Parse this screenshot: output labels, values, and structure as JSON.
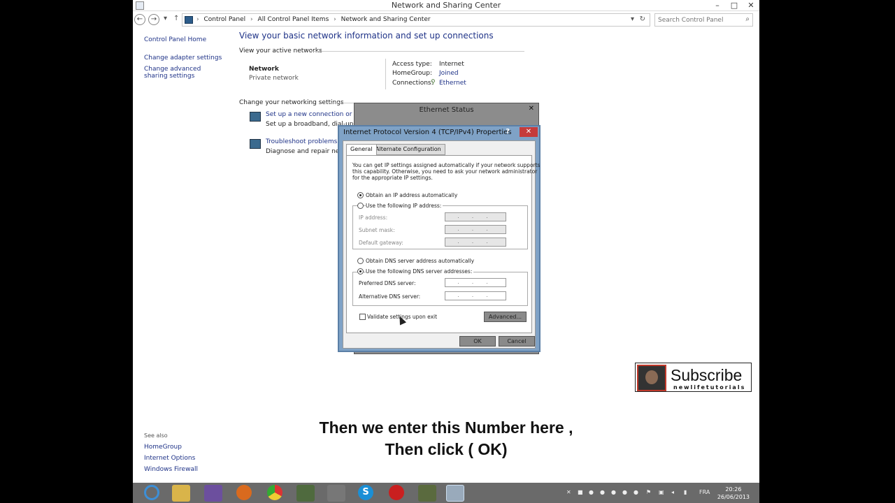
{
  "window": {
    "title": "Network and Sharing Center",
    "minimize": "–",
    "maximize": "□",
    "close": "✕"
  },
  "address_bar": {
    "breadcrumbs": [
      "Control Panel",
      "All Control Panel Items",
      "Network and Sharing Center"
    ],
    "search_placeholder": "Search Control Panel"
  },
  "sidebar": {
    "items": [
      "Control Panel Home",
      "Change adapter settings",
      "Change advanced sharing settings"
    ],
    "see_also_label": "See also",
    "see_also": [
      "HomeGroup",
      "Internet Options",
      "Windows Firewall"
    ]
  },
  "main": {
    "title": "View your basic network information and set up connections",
    "active_networks_label": "View your active networks",
    "network_name": "Network",
    "network_type": "Private network",
    "access_type_label": "Access type:",
    "access_type_value": "Internet",
    "homegroup_label": "HomeGroup:",
    "homegroup_value": "Joined",
    "connections_label": "Connections:",
    "connections_value": "Ethernet",
    "change_settings_label": "Change your networking settings",
    "setup_link": "Set up a new connection or network",
    "setup_desc": "Set up a broadband, dial-up, or VPN connection",
    "troubleshoot_link": "Troubleshoot problems",
    "troubleshoot_desc": "Diagnose and repair network problems"
  },
  "ethernet_status": {
    "title": "Ethernet Status",
    "close": "✕"
  },
  "ipv4_dialog": {
    "title": "Internet Protocol Version 4 (TCP/IPv4) Properties",
    "help": "?",
    "close": "✕",
    "tabs": [
      "General",
      "Alternate Configuration"
    ],
    "description": [
      "You can get IP settings assigned automatically if your network supports",
      "this capability. Otherwise, you need to ask your network administrator",
      "for the appropriate IP settings."
    ],
    "obtain_ip_auto": "Obtain an IP address automatically",
    "use_following_ip": "Use the following IP address:",
    "ip_address_label": "IP address:",
    "subnet_mask_label": "Subnet mask:",
    "default_gateway_label": "Default gateway:",
    "obtain_dns_auto": "Obtain DNS server address automatically",
    "use_following_dns": "Use the following DNS server addresses:",
    "preferred_dns_label": "Preferred DNS server:",
    "alternate_dns_label": "Alternative DNS server:",
    "ip_placeholder": ". . .",
    "validate_label": "Validate settings upon exit",
    "advanced_button": "Advanced...",
    "ok_button": "OK",
    "cancel_button": "Cancel",
    "selected_ip_option": "obtain_ip_auto",
    "selected_dns_option": "use_following_dns",
    "validate_checked": false
  },
  "subscribe": {
    "label": "Subscribe",
    "channel": "newlifetutorials"
  },
  "caption": {
    "line1": "Then we enter this Number here ,",
    "line2": "Then click ( OK)"
  },
  "taskbar": {
    "apps": [
      "internet-explorer-icon",
      "file-explorer-icon",
      "visual-studio-icon",
      "firefox-icon",
      "chrome-icon",
      "app-icon",
      "app-icon",
      "skype-icon",
      "opera-icon",
      "app-icon",
      "control-panel-icon"
    ],
    "language": "FRA",
    "time": "20:26",
    "date": "26/06/2013"
  }
}
